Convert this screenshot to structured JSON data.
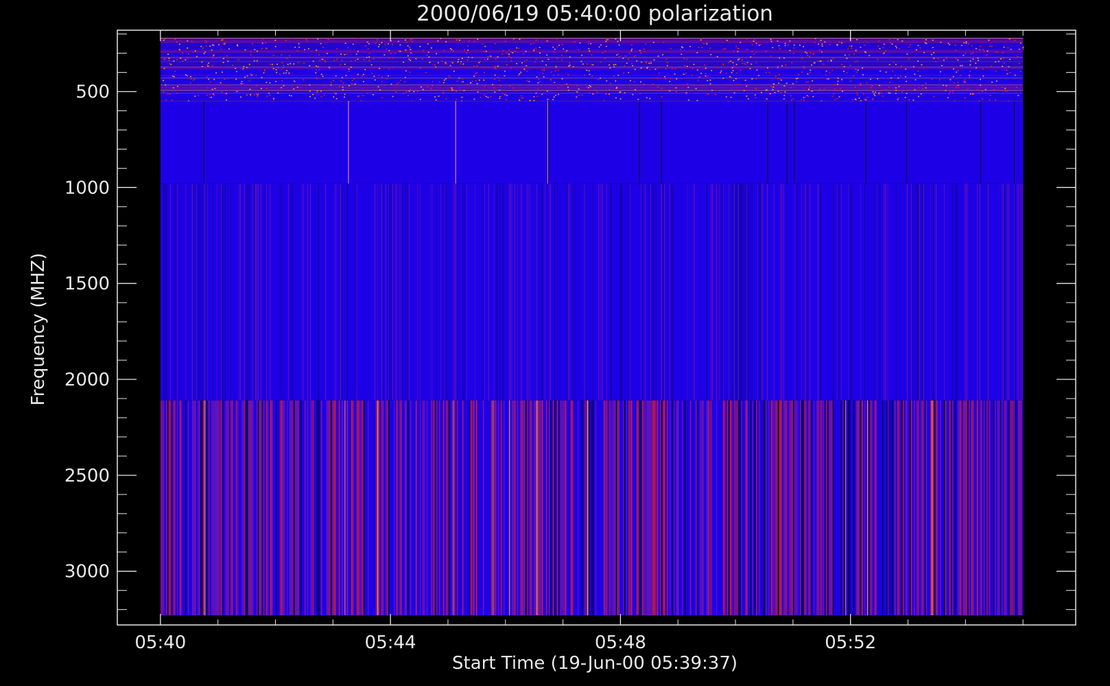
{
  "colors": {
    "background": "#000000",
    "foreground": "#e8e8e8",
    "base_blue": "#1e00e6",
    "band_red": "#e02020",
    "band_purple": "#7a1aa8",
    "band_orange": "#ff9a40"
  },
  "chart_data": {
    "type": "heatmap",
    "title": "2000/06/19 05:40:00 polarization",
    "xlabel": "Start Time (19-Jun-00 05:39:37)",
    "ylabel": "Frequency (MHZ)",
    "x_ticks": [
      "05:40",
      "05:44",
      "05:48",
      "05:52"
    ],
    "y_ticks": [
      500,
      1000,
      1500,
      2000,
      2500,
      3000
    ],
    "xlim": [
      "05:39:15",
      "05:55:55"
    ],
    "ylim": [
      3280,
      180
    ],
    "y_inverted": true,
    "data_extent": {
      "time": [
        "05:40:00",
        "05:55:00"
      ],
      "frequency_mhz": [
        220,
        3230
      ]
    },
    "bands": [
      {
        "frequency_mhz": [
          220,
          550
        ],
        "appearance": "dense horizontal channel striping, red/orange speckle"
      },
      {
        "frequency_mhz": [
          550,
          980
        ],
        "appearance": "nearly uniform blue with a few vertical lines"
      },
      {
        "frequency_mhz": [
          980,
          2110
        ],
        "appearance": "blue with fine purple vertical striping"
      },
      {
        "frequency_mhz": [
          2110,
          3230
        ],
        "appearance": "strong red/purple vertical striping"
      }
    ],
    "grid": false,
    "legend": "none"
  }
}
